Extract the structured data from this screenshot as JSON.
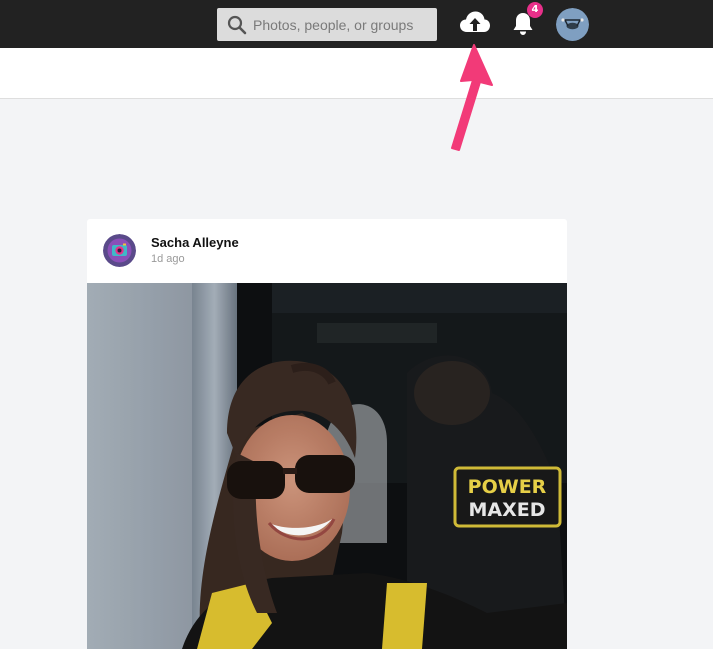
{
  "search": {
    "placeholder": "Photos, people, or groups"
  },
  "notifications": {
    "count": "4"
  },
  "post": {
    "author": "Sacha Alleyne",
    "time": "1d ago"
  },
  "photo_text": {
    "line1": "POWER",
    "line2": "MAXED"
  },
  "colors": {
    "topbar": "#222222",
    "badge": "#e8308a",
    "arrow": "#f23a78"
  },
  "icons": [
    "search-icon",
    "upload-icon",
    "bell-icon",
    "avatar",
    "arrow-annotation"
  ]
}
